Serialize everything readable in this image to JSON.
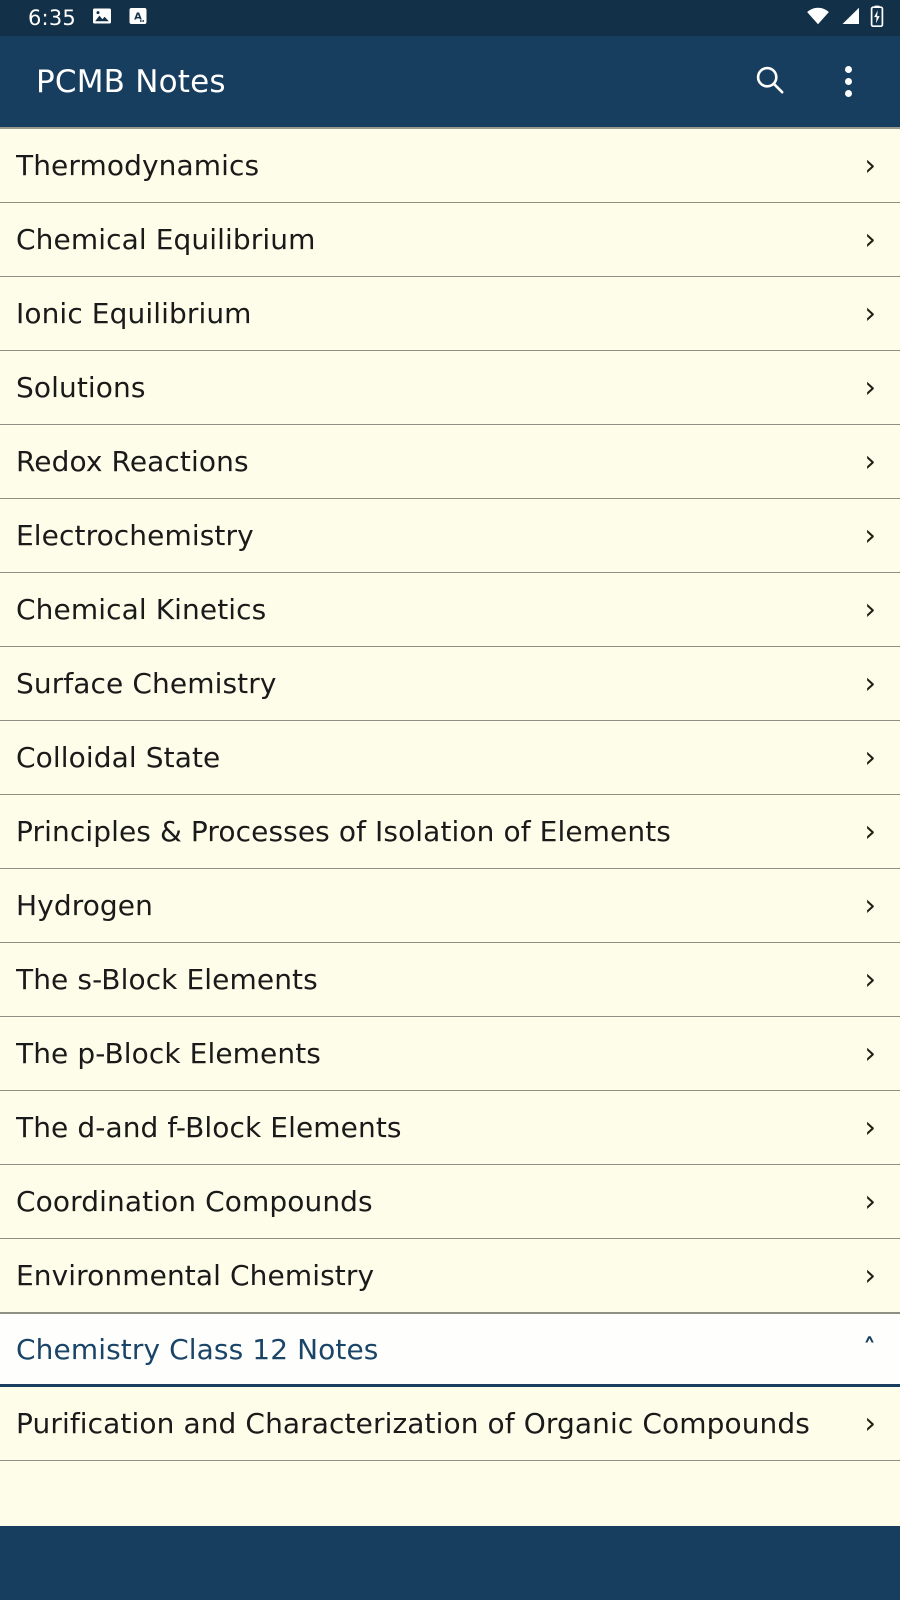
{
  "status_bar": {
    "time": "6:35",
    "left_icons": [
      "image-icon",
      "translate-icon"
    ],
    "right_icons": [
      "wifi-icon",
      "cellular-signal-icon",
      "battery-charging-icon"
    ],
    "background_color": "#123048",
    "foreground_color": "#ffffff"
  },
  "app_bar": {
    "title": "PCMB Notes",
    "background_color": "#173e5e",
    "title_color": "#ffffff",
    "actions": [
      {
        "name": "search-icon",
        "label": "Search"
      },
      {
        "name": "overflow-menu-icon",
        "label": "More options"
      }
    ]
  },
  "theme": {
    "list_background": "#fdfde9",
    "section_background": "#fefffd",
    "divider_color": "#8f8f84",
    "accent_blue": "#1b4568",
    "text_color": "#1a1a1a"
  },
  "list": {
    "items": [
      {
        "label": "Thermodynamics",
        "chevron": "chevron-right",
        "type": "item"
      },
      {
        "label": "Chemical Equilibrium",
        "chevron": "chevron-right",
        "type": "item"
      },
      {
        "label": "Ionic Equilibrium",
        "chevron": "chevron-right",
        "type": "item"
      },
      {
        "label": "Solutions",
        "chevron": "chevron-right",
        "type": "item"
      },
      {
        "label": "Redox Reactions",
        "chevron": "chevron-right",
        "type": "item"
      },
      {
        "label": "Electrochemistry",
        "chevron": "chevron-right",
        "type": "item"
      },
      {
        "label": "Chemical Kinetics",
        "chevron": "chevron-right",
        "type": "item"
      },
      {
        "label": "Surface Chemistry",
        "chevron": "chevron-right",
        "type": "item"
      },
      {
        "label": "Colloidal State",
        "chevron": "chevron-right",
        "type": "item"
      },
      {
        "label": "Principles & Processes of Isolation of Elements",
        "chevron": "chevron-right",
        "type": "item"
      },
      {
        "label": "Hydrogen",
        "chevron": "chevron-right",
        "type": "item"
      },
      {
        "label": "The s-Block Elements",
        "chevron": "chevron-right",
        "type": "item"
      },
      {
        "label": "The p-Block Elements",
        "chevron": "chevron-right",
        "type": "item"
      },
      {
        "label": "The d-and f-Block Elements",
        "chevron": "chevron-right",
        "type": "item"
      },
      {
        "label": "Coordination Compounds",
        "chevron": "chevron-right",
        "type": "item"
      },
      {
        "label": "Environmental Chemistry",
        "chevron": "chevron-right",
        "type": "item"
      },
      {
        "label": "Chemistry Class 12 Notes",
        "chevron": "chevron-up",
        "type": "section"
      },
      {
        "label": "Purification and Characterization of Organic Compounds",
        "chevron": "chevron-right",
        "type": "item"
      }
    ]
  },
  "glyphs": {
    "chevron-right": "›",
    "chevron-up": "˄"
  },
  "nav_bar": {
    "background_color": "#173e5e"
  }
}
